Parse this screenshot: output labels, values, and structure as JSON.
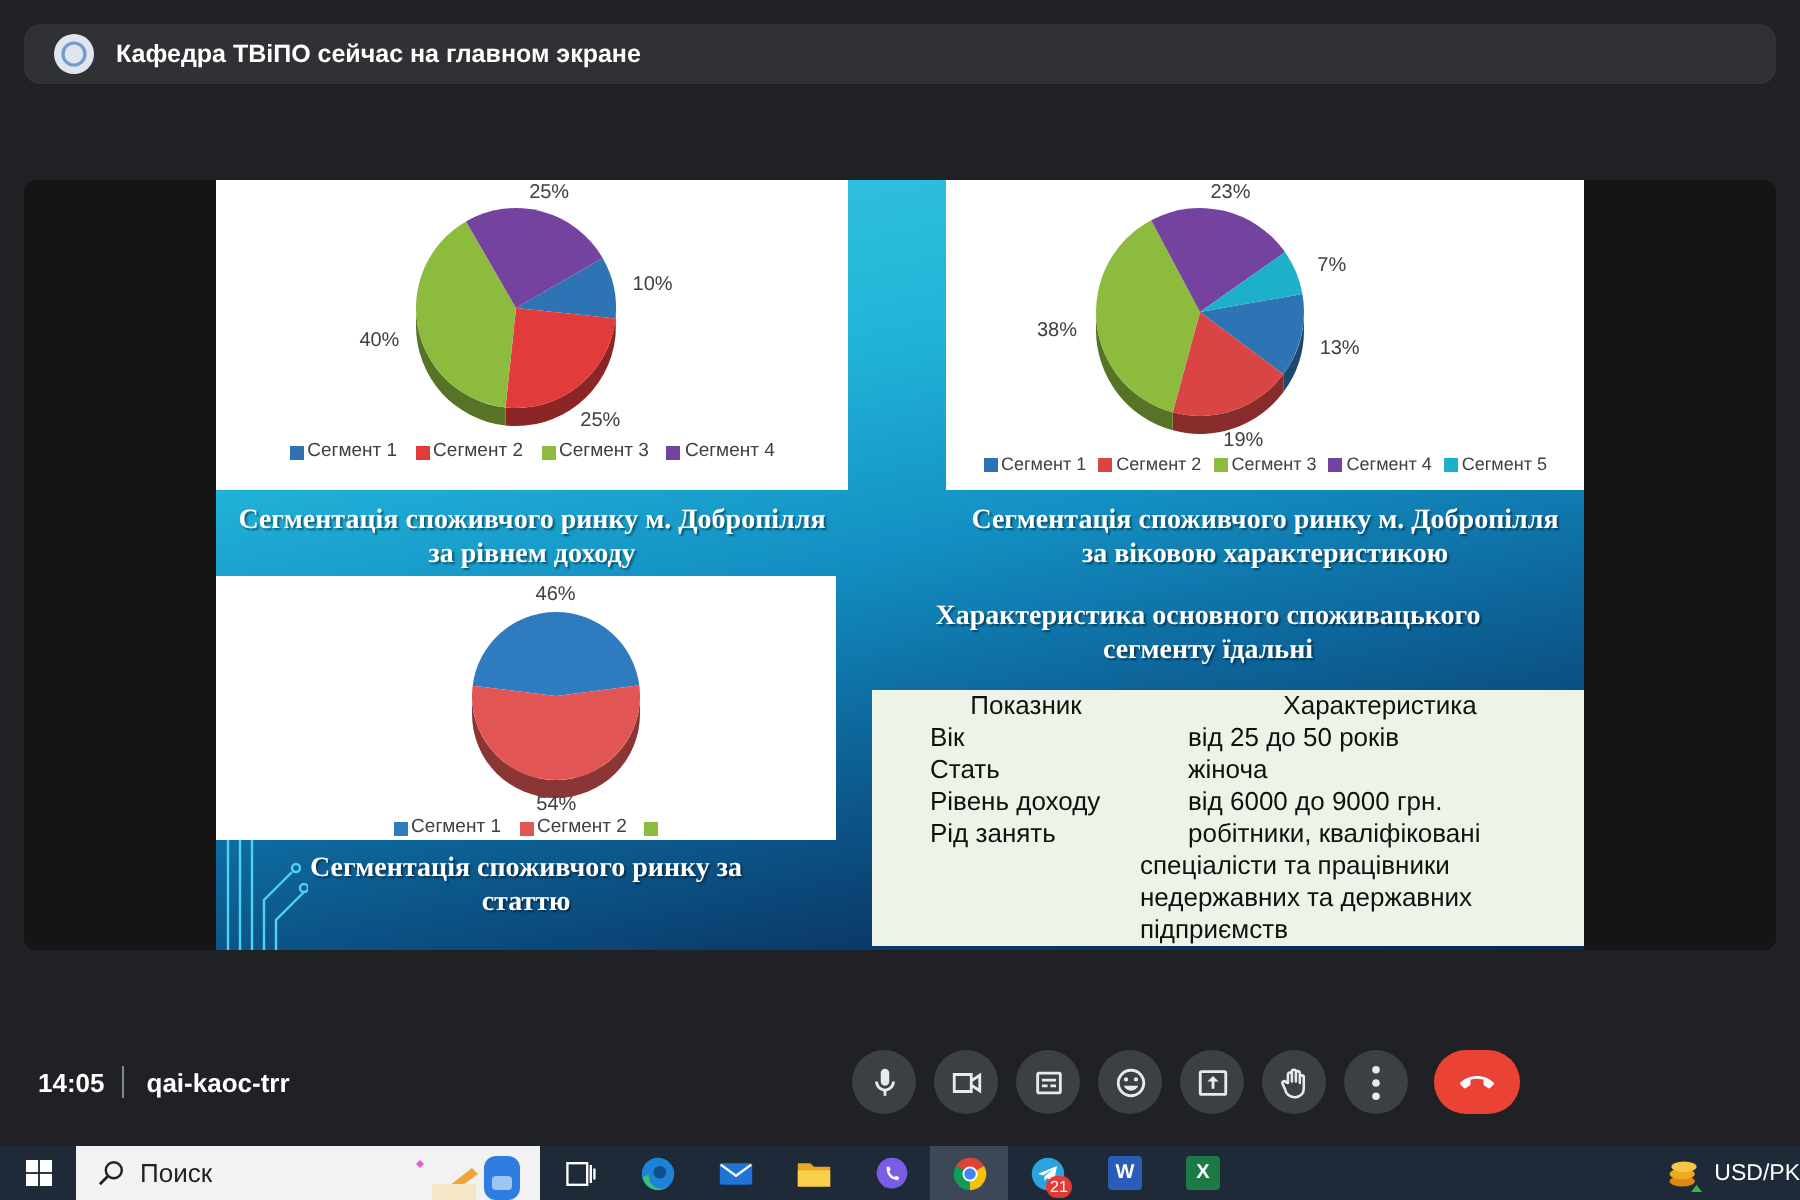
{
  "presenter_banner": {
    "text": "Кафедра ТВіПО сейчас на главном экране"
  },
  "slide": {
    "charts": [
      {
        "caption": "Сегментація споживчого ринку м. Добропілля за рівнем доходу",
        "chart_data": {
          "type": "pie",
          "categories": [
            "Сегмент 1",
            "Сегмент 2",
            "Сегмент 3",
            "Сегмент 4"
          ],
          "values": [
            10,
            25,
            40,
            25
          ],
          "colors": [
            "#2e74b5",
            "#e23b3b",
            "#8dbb3e",
            "#7443a0"
          ],
          "value_labels": [
            "10%",
            "25%",
            "40%",
            "25%"
          ],
          "legend": "bottom"
        }
      },
      {
        "caption": "Сегментація споживчого ринку м. Добропілля за віковою характеристикою",
        "chart_data": {
          "type": "pie",
          "categories": [
            "Сегмент 1",
            "Сегмент 2",
            "Сегмент 3",
            "Сегмент 4",
            "Сегмент 5"
          ],
          "values": [
            13,
            19,
            38,
            23,
            7
          ],
          "colors": [
            "#2e74b5",
            "#d94545",
            "#8dbb3e",
            "#7443a0",
            "#1fb0c9"
          ],
          "value_labels": [
            "13%",
            "19%",
            "38%",
            "23%",
            "7%"
          ],
          "legend": "bottom"
        }
      },
      {
        "caption": "Сегментація споживчого ринку за статтю",
        "chart_data": {
          "type": "pie",
          "categories": [
            "Сегмент 1",
            "Сегмент 2"
          ],
          "values": [
            46,
            54
          ],
          "colors": [
            "#2e7bc0",
            "#e25555"
          ],
          "value_labels": [
            "46%",
            "54%"
          ],
          "legend": "bottom"
        },
        "legend_extra_swatch": {
          "color": "#8dbb3e"
        }
      }
    ],
    "table_heading": "Характеристика основного споживацького сегменту їдальні",
    "table": {
      "columns": [
        "Показник",
        "Характеристика"
      ],
      "rows": [
        [
          "Вік",
          "від 25 до 50 років"
        ],
        [
          "Стать",
          "жіноча"
        ],
        [
          "Рівень доходу",
          "від 6000 до 9000 грн."
        ],
        [
          "Рід занять",
          "робітники, кваліфіковані спеціалісти та працівники недержавних та державних підприємств"
        ]
      ]
    }
  },
  "call_bar": {
    "time": "14:05",
    "meeting_code": "qai-kaoc-trr",
    "controls": [
      {
        "kind": "microphone"
      },
      {
        "kind": "camera"
      },
      {
        "kind": "captions"
      },
      {
        "kind": "reactions"
      },
      {
        "kind": "present"
      },
      {
        "kind": "raise-hand"
      },
      {
        "kind": "more"
      },
      {
        "kind": "leave"
      }
    ]
  },
  "taskbar": {
    "search_placeholder": "Поиск",
    "apps": [
      {
        "kind": "task-view",
        "selected": false
      },
      {
        "kind": "edge",
        "selected": false
      },
      {
        "kind": "mail",
        "selected": false
      },
      {
        "kind": "explorer",
        "selected": false
      },
      {
        "kind": "viber",
        "selected": false
      },
      {
        "kind": "chrome",
        "selected": true
      },
      {
        "kind": "telegram",
        "selected": false,
        "badge": "21"
      },
      {
        "kind": "word",
        "selected": false,
        "glyph": "W"
      },
      {
        "kind": "excel",
        "selected": false,
        "glyph": "X"
      }
    ],
    "tray_text": "USD/PK"
  }
}
